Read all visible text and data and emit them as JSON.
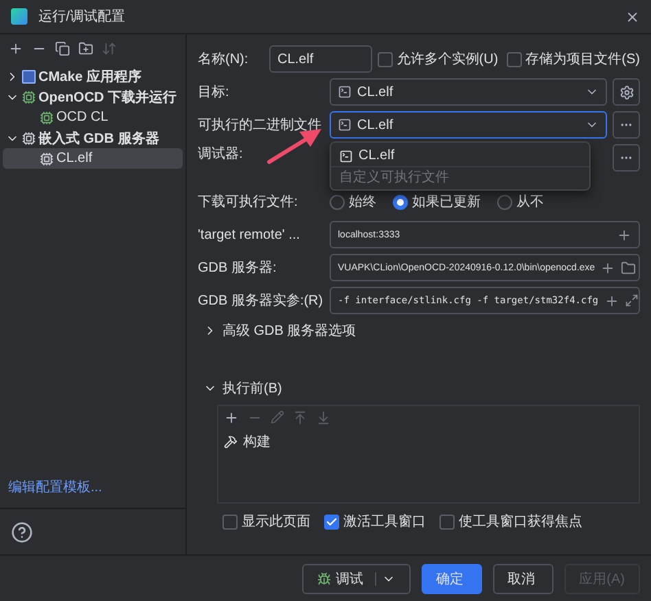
{
  "window": {
    "title": "运行/调试配置"
  },
  "sidebar": {
    "tree": [
      {
        "label": "CMake 应用程序",
        "kind": "cmake",
        "expanded": false,
        "selected": false
      },
      {
        "label": "OpenOCD 下载并运行",
        "kind": "openocd",
        "expanded": true,
        "selected": false,
        "children": [
          {
            "label": "OCD CL",
            "kind": "openocd",
            "selected": false
          }
        ]
      },
      {
        "label": "嵌入式 GDB 服务器",
        "kind": "gdb",
        "expanded": true,
        "selected": false,
        "children": [
          {
            "label": "CL.elf",
            "kind": "gdb",
            "selected": true
          }
        ]
      }
    ],
    "link": "编辑配置模板..."
  },
  "form": {
    "name": {
      "label": "名称(N):",
      "value": "CL.elf"
    },
    "options": [
      {
        "label": "允许多个实例(U)",
        "checked": false
      },
      {
        "label": "存储为项目文件(S)",
        "checked": false
      }
    ],
    "target": {
      "label": "目标:",
      "value": "CL.elf"
    },
    "executable": {
      "label": "可执行的二进制文件",
      "value": "CL.elf",
      "expanded": true,
      "options": [
        {
          "label": "CL.elf",
          "kind": "item"
        },
        {
          "label": "自定义可执行文件",
          "kind": "hint"
        }
      ]
    },
    "debugger": {
      "label": "调试器:"
    },
    "download": {
      "label": "下载可执行文件:",
      "options": [
        {
          "label": "始终",
          "selected": false
        },
        {
          "label": "如果已更新",
          "selected": true
        },
        {
          "label": "从不",
          "selected": false
        }
      ]
    },
    "fields": [
      {
        "label": "'target remote' ...",
        "value": "localhost:3333",
        "kind": "plain"
      },
      {
        "label": "GDB 服务器:",
        "value": "VUAPK\\CLion\\OpenOCD-20240916-0.12.0\\bin\\openocd.exe",
        "kind": "path"
      },
      {
        "label": "GDB 服务器实参:(R)",
        "value": "-f interface/stlink.cfg -f target/stm32f4.cfg",
        "kind": "args"
      }
    ],
    "advanced": {
      "label": "高级 GDB 服务器选项",
      "expanded": false
    },
    "before_launch": {
      "label": "执行前(B)",
      "expanded": true,
      "tasks": [
        "构建"
      ]
    },
    "launch_options": [
      {
        "label": "显示此页面",
        "checked": false
      },
      {
        "label": "激活工具窗口",
        "checked": true
      },
      {
        "label": "使工具窗口获得焦点",
        "checked": false
      }
    ]
  },
  "buttons": [
    {
      "label": "调试",
      "kind": "split",
      "disabled": false
    },
    {
      "label": "确定",
      "kind": "primary",
      "disabled": false
    },
    {
      "label": "取消",
      "kind": "normal",
      "disabled": false
    },
    {
      "label": "应用(A)",
      "kind": "normal",
      "disabled": true
    }
  ]
}
